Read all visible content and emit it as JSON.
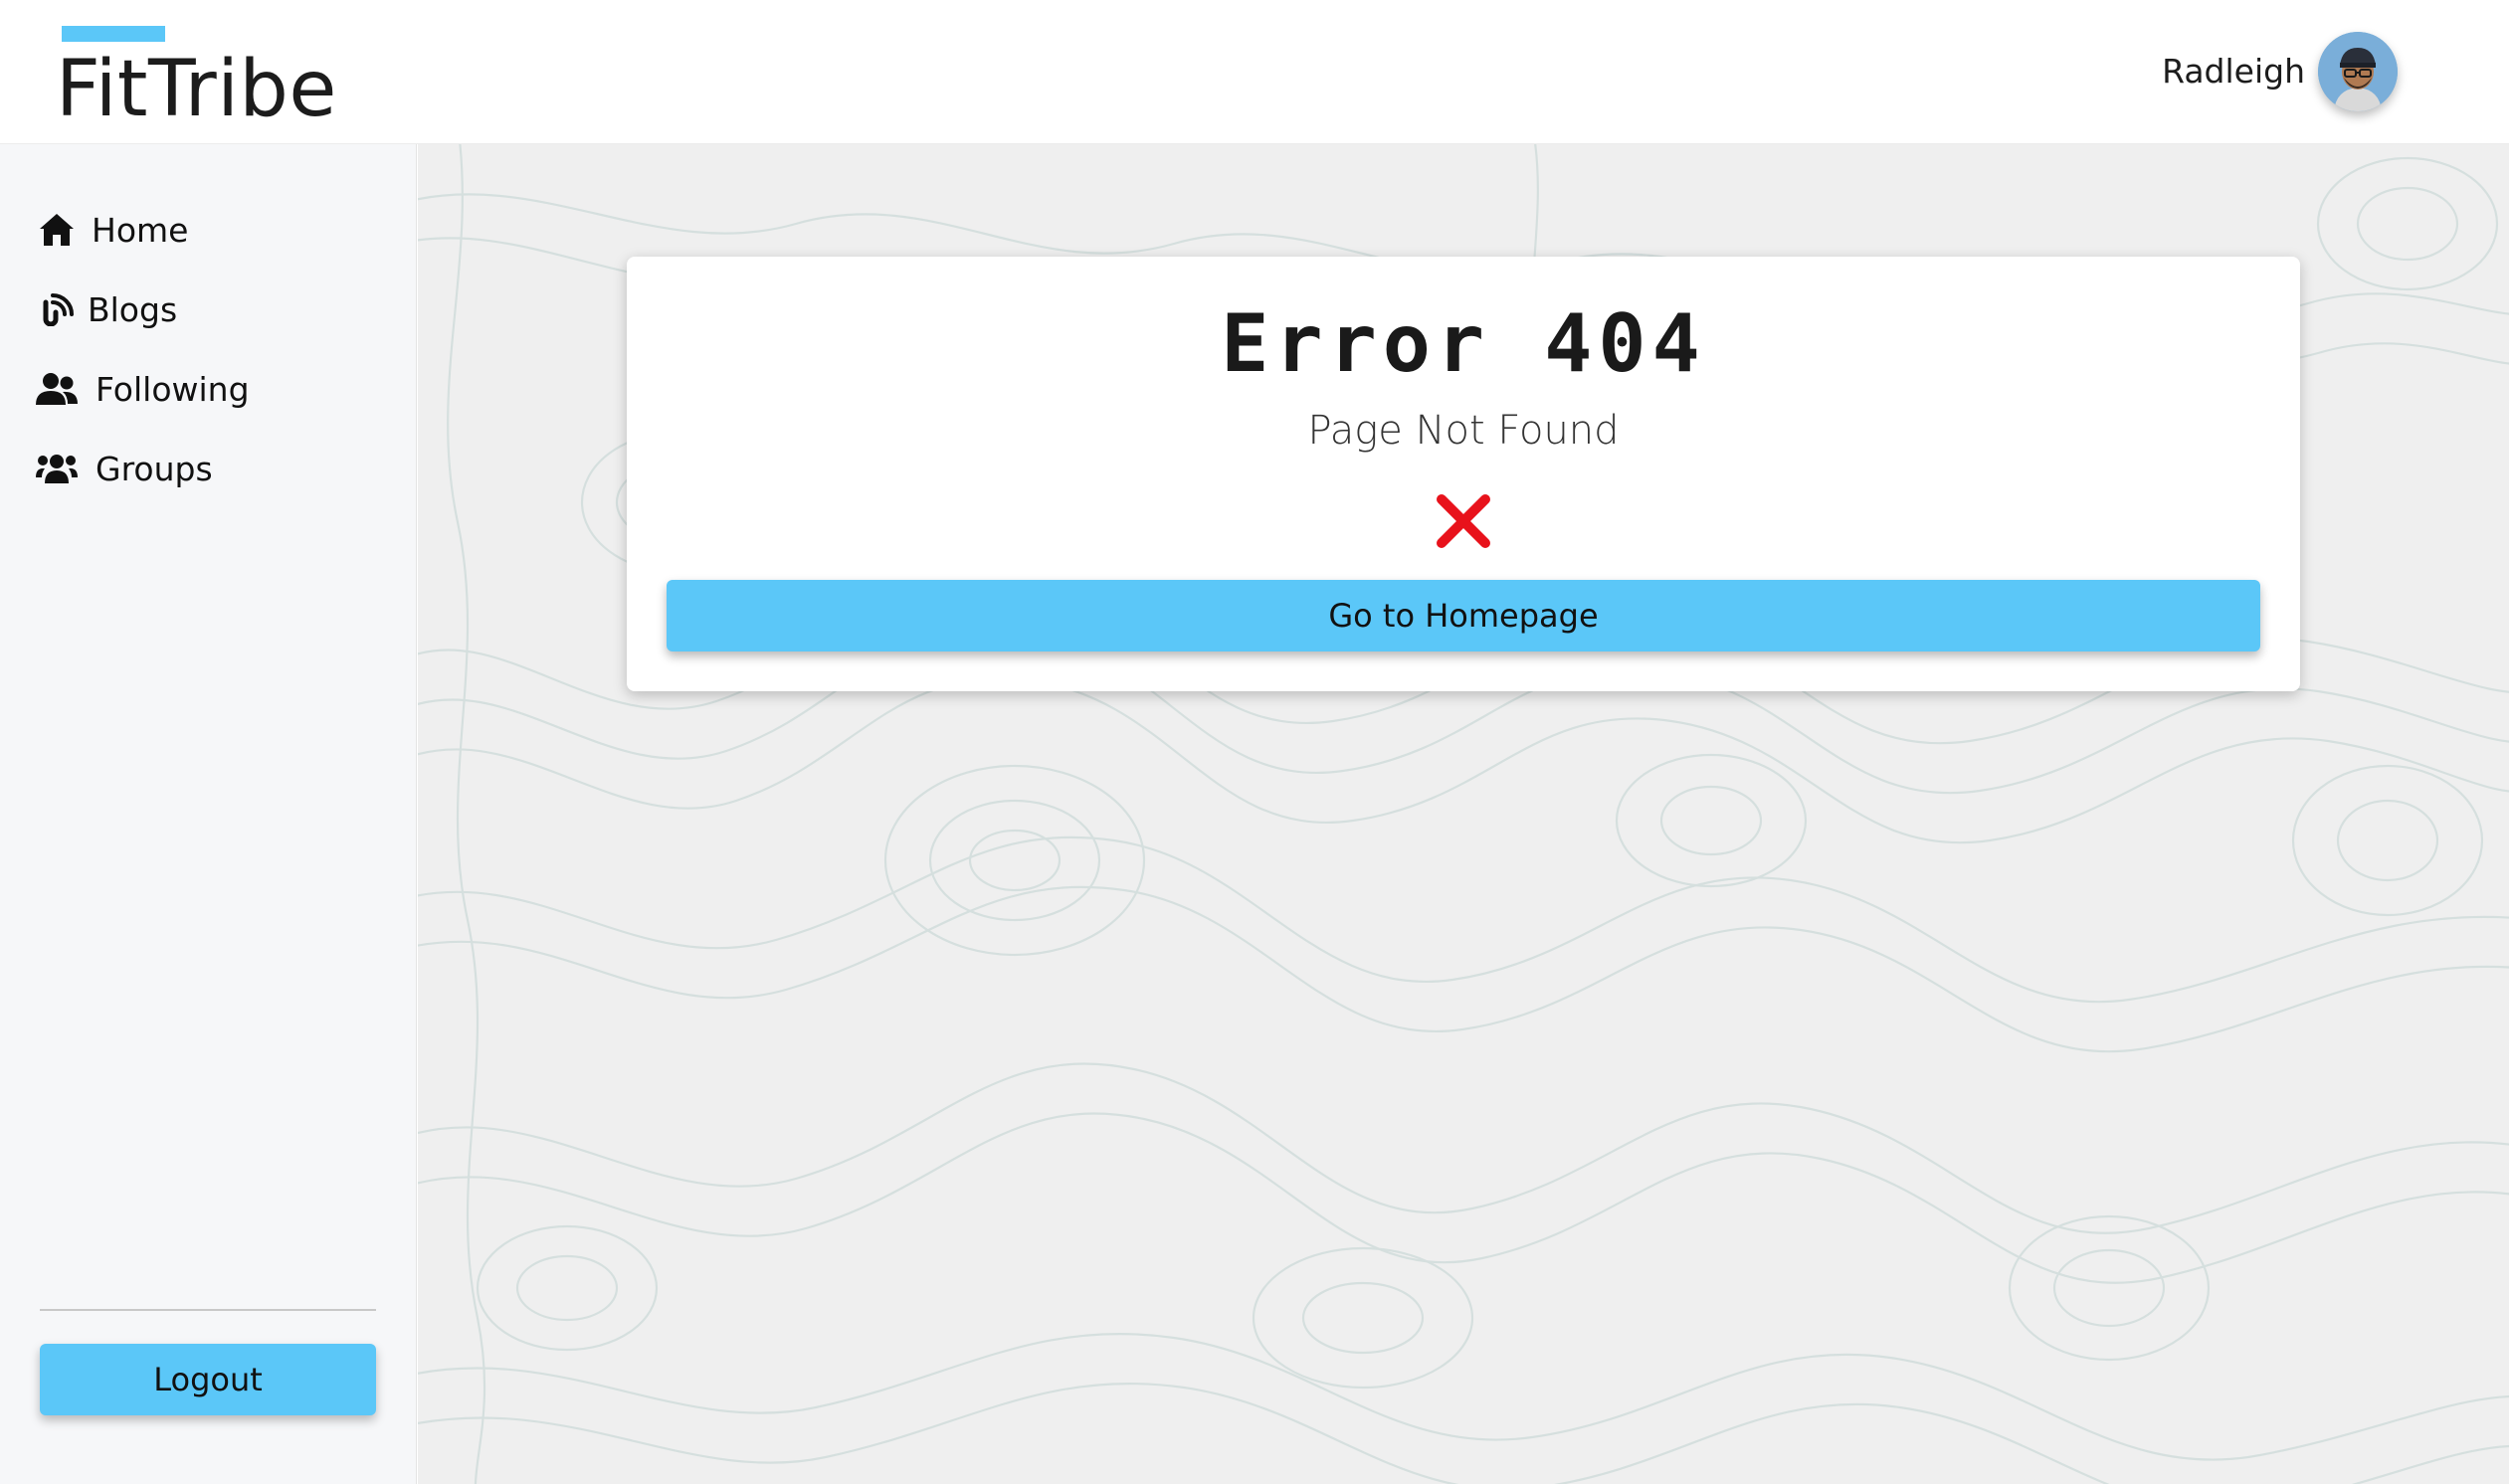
{
  "app": {
    "name": "FitTribe",
    "accent_color": "#5bc7f8"
  },
  "header": {
    "user_name": "Radleigh",
    "avatar_icon": "user-avatar"
  },
  "sidebar": {
    "items": [
      {
        "label": "Home",
        "icon": "home-icon"
      },
      {
        "label": "Blogs",
        "icon": "blog-icon"
      },
      {
        "label": "Following",
        "icon": "user-friends-icon"
      },
      {
        "label": "Groups",
        "icon": "users-group-icon"
      }
    ],
    "logout_label": "Logout"
  },
  "error": {
    "title": "Error 404",
    "subtitle": "Page Not Found",
    "icon": "cross-mark-icon",
    "icon_color": "#e8121b",
    "button_label": "Go to Homepage"
  }
}
